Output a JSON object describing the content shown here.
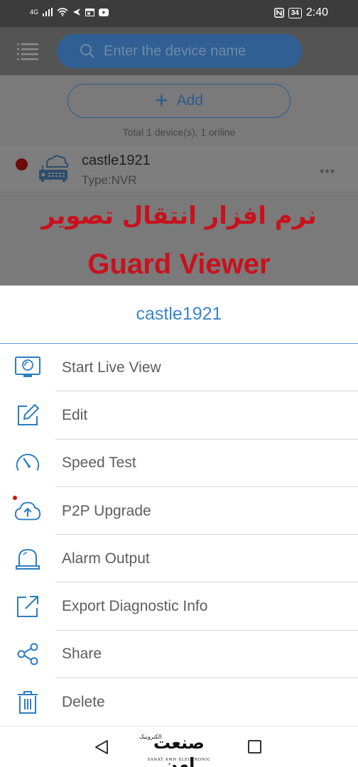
{
  "status_bar": {
    "network": "4G",
    "battery": "34",
    "time": "2:40"
  },
  "header": {
    "search_placeholder": "Enter the device name"
  },
  "device_list": {
    "add_label": "Add",
    "summary": "Total 1 device(s), 1 online",
    "devices": [
      {
        "name": "castle1921",
        "type": "Type:NVR",
        "more": "•••"
      }
    ]
  },
  "overlay": {
    "persian_title": "نرم افزار انتقال تصویر",
    "english_title": "Guard Viewer"
  },
  "sheet": {
    "title": "castle1921",
    "items": [
      {
        "label": "Start Live View",
        "icon": "live-view-icon"
      },
      {
        "label": "Edit",
        "icon": "edit-icon"
      },
      {
        "label": "Speed Test",
        "icon": "speedometer-icon"
      },
      {
        "label": "P2P Upgrade",
        "icon": "cloud-upload-icon",
        "badge": true
      },
      {
        "label": "Alarm Output",
        "icon": "alarm-light-icon"
      },
      {
        "label": "Export Diagnostic Info",
        "icon": "export-icon"
      },
      {
        "label": "Share",
        "icon": "share-icon"
      },
      {
        "label": "Delete",
        "icon": "trash-icon"
      }
    ]
  },
  "watermark": {
    "logo_text": "صنعت امن",
    "small_text": "الکترونیک",
    "english_text": "SANAT AMN ELECTRONIC"
  },
  "colors": {
    "accent": "#3a86c8",
    "icon_blue": "#2c7cc1",
    "overlay_red": "#c8111c"
  }
}
